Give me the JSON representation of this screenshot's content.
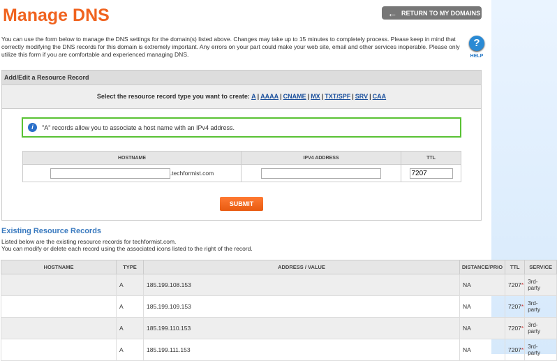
{
  "header": {
    "title": "Manage DNS",
    "back_label": "RETURN TO MY DOMAINS"
  },
  "intro": "You can use the form below to manage the DNS settings for the domain(s) listed above. Changes may take up to 15 minutes to completely process. Please keep in mind that correctly modifying the DNS records for this domain is extremely important. Any errors on your part could make your web site, email and other services inoperable. Please only utilize this form if you are comfortable and experienced managing DNS.",
  "help": {
    "label": "HELP",
    "glyph": "?"
  },
  "panel": {
    "title": "Add/Edit a Resource Record",
    "select_prompt": "Select the resource record type you want to create:",
    "types": [
      "A",
      "AAAA",
      "CNAME",
      "MX",
      "TXT/SPF",
      "SRV",
      "CAA"
    ],
    "info": "\"A\" records allow you to associate a host name with an IPv4 address.",
    "info_glyph": "i",
    "form": {
      "headers": {
        "hostname": "HOSTNAME",
        "ipv4": "IPV4 ADDRESS",
        "ttl": "TTL"
      },
      "domain_suffix": ".techformist.com",
      "hostname_value": "",
      "ipv4_value": "",
      "ttl_value": "7207"
    },
    "submit_label": "SUBMIT"
  },
  "existing": {
    "title": "Existing Resource Records",
    "desc_line1": "Listed below are the existing resource records for techformist.com.",
    "desc_line2": "You can modify or delete each record using the associated icons listed to the right of the record.",
    "headers": [
      "HOSTNAME",
      "TYPE",
      "ADDRESS / VALUE",
      "DISTANCE/PRIO",
      "TTL",
      "SERVICE"
    ],
    "rows": [
      {
        "hostname": "",
        "type": "A",
        "value": "185.199.108.153",
        "prio": "NA",
        "ttl": "7207",
        "service_line1": "3rd-",
        "service_line2": "party"
      },
      {
        "hostname": "",
        "type": "A",
        "value": "185.199.109.153",
        "prio": "NA",
        "ttl": "7207",
        "service_line1": "3rd-",
        "service_line2": "party"
      },
      {
        "hostname": "",
        "type": "A",
        "value": "185.199.110.153",
        "prio": "NA",
        "ttl": "7207",
        "service_line1": "3rd-",
        "service_line2": "party"
      },
      {
        "hostname": "",
        "type": "A",
        "value": "185.199.111.153",
        "prio": "NA",
        "ttl": "7207",
        "service_line1": "3rd-",
        "service_line2": "party"
      }
    ],
    "ttl_marker": "*"
  },
  "colors": {
    "title": "#f0631f",
    "link": "#1a4f9c",
    "info_border": "#59c234",
    "submit": "#f06a22"
  }
}
